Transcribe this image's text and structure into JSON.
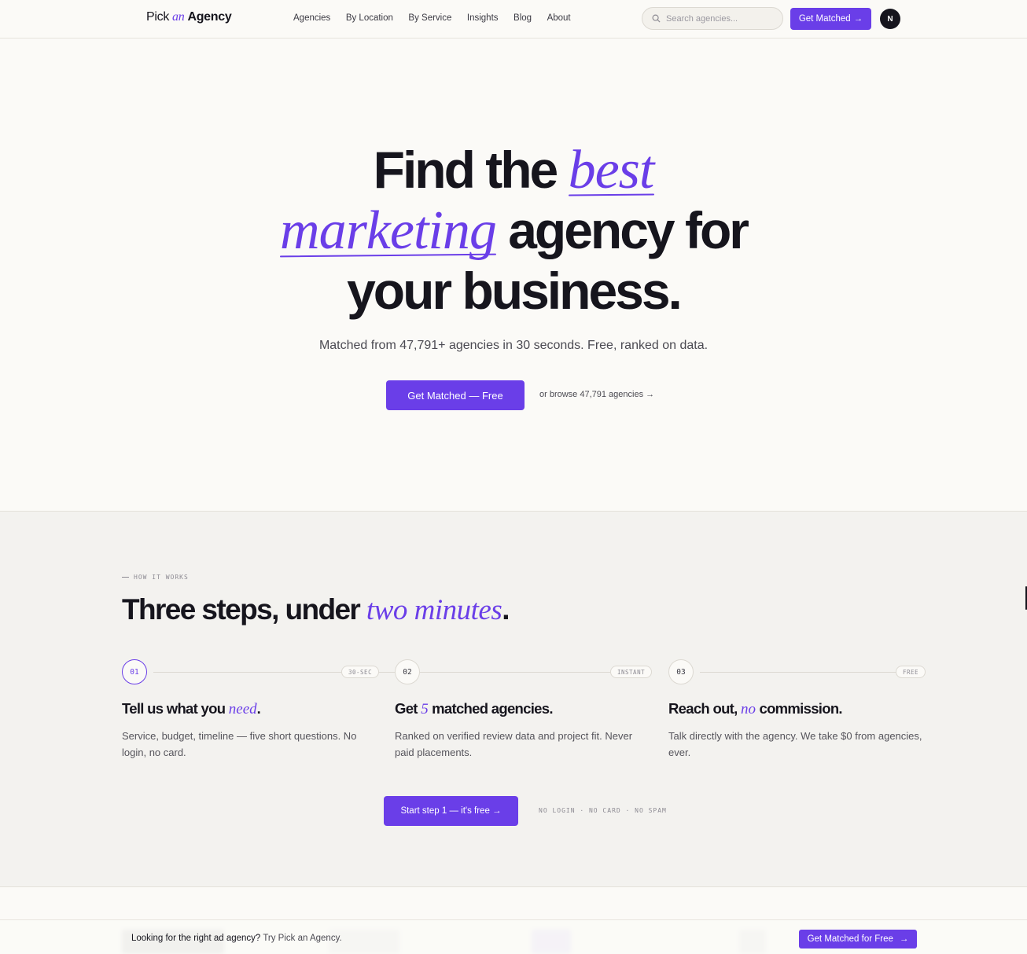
{
  "nav": {
    "logo": {
      "part1": "Pick",
      "part2": "an",
      "part3": "Agency"
    },
    "links": [
      "Agencies",
      "By Location",
      "By Service",
      "Insights",
      "Blog",
      "About"
    ],
    "search_placeholder": "Search agencies...",
    "cta": "Get Matched",
    "cta_arrow": "→",
    "avatar": "N"
  },
  "hero": {
    "line1_a": "Find the",
    "line1_b": "best",
    "line2_a": "marketing",
    "line2_b": "agency for",
    "line3": "your business.",
    "subtitle": "Matched from 47,791+ agencies in 30 seconds. Free, ranked on data.",
    "cta": "Get Matched — Free",
    "browse": "or browse 47,791 agencies →"
  },
  "how": {
    "eyebrow": "HOW IT WORKS",
    "title_a": "Three steps, under",
    "title_b": "two minutes",
    "title_c": ".",
    "steps": [
      {
        "num": "01",
        "tag": "30-SEC",
        "title_a": "Tell us what you",
        "title_b": "need",
        "title_c": ".",
        "desc": "Service, budget, timeline — five short questions. No login, no card."
      },
      {
        "num": "02",
        "tag": "INSTANT",
        "title_a": "Get",
        "title_b": "5",
        "title_c": "matched agencies.",
        "desc": "Ranked on verified review data and project fit. Never paid placements."
      },
      {
        "num": "03",
        "tag": "FREE",
        "title_a": "Reach out,",
        "title_b": "no",
        "title_c": "commission.",
        "desc": "Talk directly with the agency. We take $0 from agencies, ever."
      }
    ],
    "cta": "Start step 1 — it's free →",
    "fine_print": "NO LOGIN · NO CARD · NO SPAM"
  },
  "banner": {
    "text_bold": "Looking for the right ad agency?",
    "text_muted": "Try Pick an Agency.",
    "cta": "Get Matched for Free",
    "cta_arrow": "→"
  },
  "colors": {
    "accent": "#6a3ee8",
    "ink": "#16151d",
    "background": "#fbfaf7",
    "section": "#f3f2ef"
  }
}
